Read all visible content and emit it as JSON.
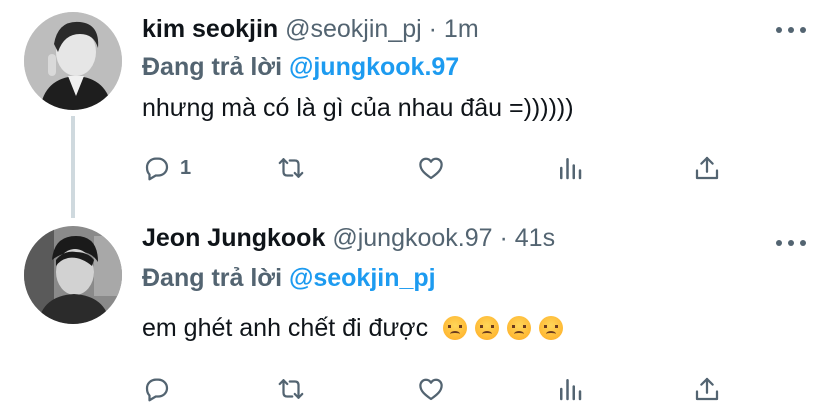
{
  "tweets": [
    {
      "author_name": "kim seokjin",
      "handle": "@seokjin_pj",
      "separator": "·",
      "time": "1m",
      "reply_prefix": "Đang trả lời",
      "reply_handle": "@jungkook.97",
      "text": "nhưng mà có là gì của nhau đâu =))))))",
      "reply_count": "1",
      "emoji_count": 0
    },
    {
      "author_name": "Jeon Jungkook",
      "handle": "@jungkook.97",
      "separator": "·",
      "time": "41s",
      "reply_prefix": "Đang trả lời",
      "reply_handle": "@seokjin_pj",
      "text": "em ghét anh chết đi được",
      "reply_count": "",
      "emoji_count": 4
    }
  ],
  "icons": [
    "reply-icon",
    "retweet-icon",
    "like-icon",
    "views-icon",
    "share-icon",
    "more-icon",
    "angry-face-emoji"
  ],
  "colors": {
    "text": "#0f1419",
    "muted": "#536471",
    "link": "#1d9bf0",
    "thread_line": "#cfd9de",
    "background": "#ffffff"
  }
}
